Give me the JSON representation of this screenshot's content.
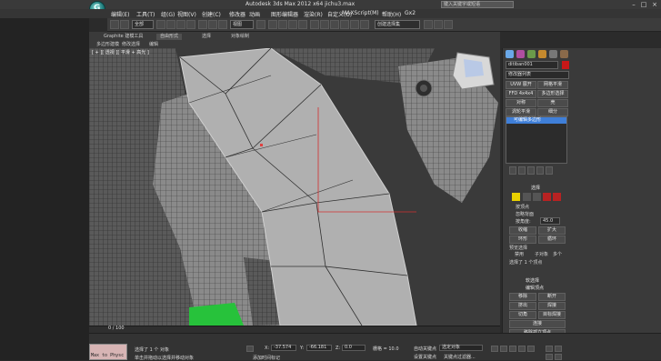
{
  "window": {
    "title": "Autodesk 3ds Max  2012 x64     jichu3.max",
    "search_placeholder": "键入关键字或短语"
  },
  "menu": {
    "items": [
      "编辑(E)",
      "工具(T)",
      "组(G)",
      "视图(V)",
      "创建(C)",
      "修改器",
      "动画",
      "图形编辑器",
      "渲染(R)",
      "自定义(U)",
      "MAXScript(M)",
      "帮助(H)",
      "Gx2"
    ]
  },
  "toolbar": {
    "selection_filter": "全部",
    "view_dropdown": "视图",
    "named_selection": "创建选择集"
  },
  "ribbon": {
    "tabs": [
      "Graphite 建模工具",
      "自由形式",
      "选择",
      "对象绘制"
    ],
    "subtitles": [
      "多边形建模",
      "修改选择",
      "编辑",
      "几何体(全部)"
    ]
  },
  "viewport": {
    "label": "[ + ][ 透视 ][ 平滑 + 高光 ]"
  },
  "command_panel": {
    "object_name": "ditiban001",
    "modifier_list": "修改器列表",
    "buttons": [
      "UVW 展开",
      "网格平滑",
      "FFD 4x4x4",
      "多边形选择",
      "对称",
      "壳",
      "涡轮平滑",
      "细分"
    ],
    "stack_item": "可编辑多边形",
    "selection_header": "选择",
    "checkbox_labels": [
      "按顶点",
      "忽略背面",
      "按角度:"
    ],
    "angle_value": "45.0",
    "shrink_label": "收缩",
    "grow_label": "扩大",
    "ring_label": "环形",
    "loop_label": "循环",
    "preview_label": "预览选择",
    "preview_options": [
      "禁用",
      "子对象",
      "多个"
    ],
    "selected_count": "选择了 1 个顶点",
    "soft_selection": "软选择",
    "edit_vertices": "编辑顶点",
    "remove_label": "移除",
    "break_label": "断开",
    "extrude_label": "挤出",
    "weld_label": "焊接",
    "chamfer_label": "切角",
    "target_weld": "目标焊接",
    "connect_label": "连接",
    "remove_isolated": "移除孤立顶点"
  },
  "timeline": {
    "frame_counter": "0 / 100"
  },
  "status": {
    "maxscript_text": "Max to Physc",
    "line1": "选择了 1 个 对象",
    "line2": "单击并拖动以选择并移动对象",
    "x_label": "X:",
    "x_value": "-37.574",
    "y_label": "Y:",
    "y_value": "-66.181",
    "z_label": "Z:",
    "z_value": "0.0",
    "grid_label": "栅格 = 10.0",
    "autokey_label": "自动关键点",
    "autokey_value": "选定对象",
    "setkey_label": "设置关键点",
    "keyfilter_label": "关键点过滤器...",
    "add_time_tag": "添加时间标记"
  },
  "colors": {
    "accent": "#3f7fd8",
    "selection_green": "#27c23b",
    "mesh_light": "#a8a8a8",
    "mesh_dark": "#2a2a2a"
  }
}
